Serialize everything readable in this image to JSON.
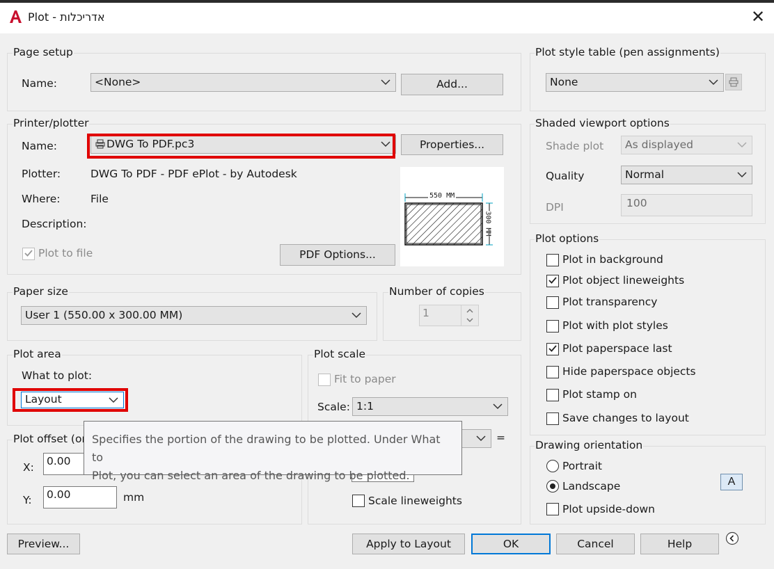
{
  "window": {
    "title": "Plot - אדריכלות"
  },
  "page_setup": {
    "label": "Page setup",
    "name_label": "Name:",
    "name_value": "<None>",
    "add_button": "Add..."
  },
  "printer": {
    "label": "Printer/plotter",
    "name_label": "Name:",
    "name_value": "DWG To PDF.pc3",
    "properties_button": "Properties...",
    "plotter_label": "Plotter:",
    "plotter_value": "DWG To PDF - PDF ePlot - by Autodesk",
    "where_label": "Where:",
    "where_value": "File",
    "description_label": "Description:",
    "plot_to_file": "Plot to file",
    "plot_to_file_checked": true,
    "pdf_options_button": "PDF Options...",
    "preview": {
      "width_label": "550 MM",
      "height_label": "300 MM"
    }
  },
  "paper_size": {
    "label": "Paper size",
    "value": "User 1 (550.00 x 300.00 MM)"
  },
  "copies": {
    "label": "Number of copies",
    "value": "1"
  },
  "plot_area": {
    "label": "Plot area",
    "what_label": "What to plot:",
    "value": "Layout"
  },
  "plot_scale": {
    "label": "Plot scale",
    "fit_to_paper": "Fit to paper",
    "scale_label": "Scale:",
    "scale_value": "1:1",
    "equals": "=",
    "scale_lineweights": "Scale lineweights"
  },
  "plot_offset": {
    "label": "Plot offset (ori",
    "x_label": "X:",
    "x_value": "0.00",
    "y_label": "Y:",
    "y_value": "0.00",
    "unit": "mm"
  },
  "tooltip": {
    "line1": "Specifies the portion of the drawing to be plotted. Under What to",
    "line2": "Plot, you can select an area of the drawing to be plotted."
  },
  "plot_style_table": {
    "label": "Plot style table (pen assignments)",
    "value": "None"
  },
  "shaded_viewport": {
    "label": "Shaded viewport options",
    "shade_plot_label": "Shade plot",
    "shade_plot_value": "As displayed",
    "quality_label": "Quality",
    "quality_value": "Normal",
    "dpi_label": "DPI",
    "dpi_value": "100"
  },
  "plot_options": {
    "label": "Plot options",
    "items": [
      {
        "label": "Plot in background",
        "checked": false
      },
      {
        "label": "Plot object lineweights",
        "checked": true
      },
      {
        "label": "Plot transparency",
        "checked": false
      },
      {
        "label": "Plot with plot styles",
        "checked": false
      },
      {
        "label": "Plot paperspace last",
        "checked": true
      },
      {
        "label": "Hide paperspace objects",
        "checked": false
      },
      {
        "label": "Plot stamp on",
        "checked": false
      },
      {
        "label": "Save changes to layout",
        "checked": false
      }
    ]
  },
  "orientation": {
    "label": "Drawing orientation",
    "portrait": "Portrait",
    "landscape": "Landscape",
    "selected": "landscape",
    "upside_down": "Plot upside-down",
    "upside_down_checked": false,
    "icon_letter": "A"
  },
  "footer": {
    "preview_button": "Preview...",
    "apply_button": "Apply to Layout",
    "ok_button": "OK",
    "cancel_button": "Cancel",
    "help_button": "Help"
  },
  "colors": {
    "highlight": "#e00000",
    "focus": "#0078d7",
    "brand": "#c8102e"
  }
}
